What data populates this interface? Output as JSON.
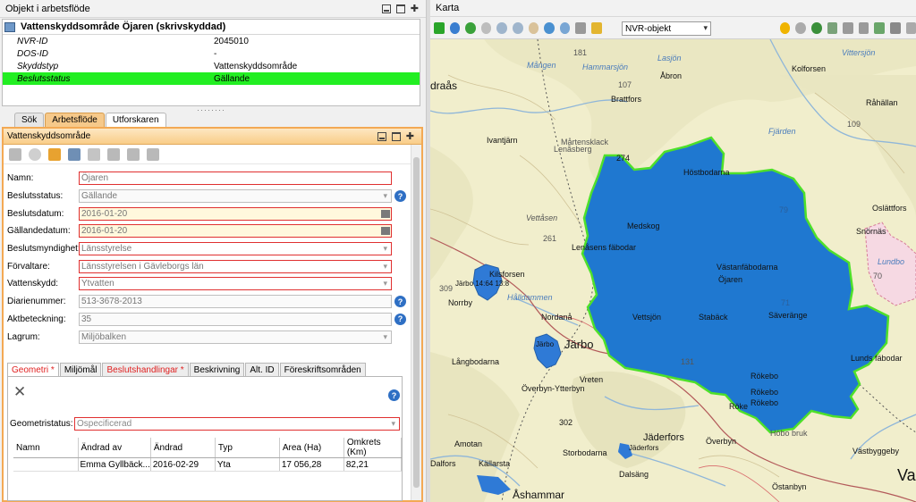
{
  "left_panel": {
    "title": "Objekt i arbetsflöde",
    "object_title": "Vattenskyddsområde Öjaren (skrivskyddad)",
    "attributes": [
      {
        "key": "NVR-ID",
        "value": "2045010"
      },
      {
        "key": "DOS-ID",
        "value": "-"
      },
      {
        "key": "Skyddstyp",
        "value": "Vattenskyddsområde"
      },
      {
        "key": "Beslutsstatus",
        "value": "Gällande"
      }
    ]
  },
  "tabs": [
    "Sök",
    "Arbetsflöde",
    "Utforskaren"
  ],
  "form": {
    "title": "Vattenskyddsområde",
    "fields": [
      {
        "label": "Namn:",
        "value": "Öjaren"
      },
      {
        "label": "Beslutsstatus:",
        "value": "Gällande"
      },
      {
        "label": "Beslutsdatum:",
        "value": "2016-01-20"
      },
      {
        "label": "Gällandedatum:",
        "value": "2016-01-20"
      },
      {
        "label": "Beslutsmyndighet:",
        "value": "Länsstyrelse"
      },
      {
        "label": "Förvaltare:",
        "value": "Länsstyrelsen i Gävleborgs län"
      },
      {
        "label": "Vattenskydd:",
        "value": "Ytvatten"
      },
      {
        "label": "Diarienummer:",
        "value": "513-3678-2013"
      },
      {
        "label": "Aktbeteckning:",
        "value": "35"
      },
      {
        "label": "Lagrum:",
        "value": "Miljöbalken"
      }
    ],
    "subtabs": [
      {
        "label": "Geometri",
        "star": "*"
      },
      {
        "label": "Miljömål",
        "star": ""
      },
      {
        "label": "Beslutshandlingar",
        "star": "*"
      },
      {
        "label": "Beskrivning",
        "star": ""
      },
      {
        "label": "Alt. ID",
        "star": ""
      },
      {
        "label": "Föreskriftsområden",
        "star": ""
      }
    ],
    "geometry_status_label": "Geometristatus:",
    "geometry_status_value": "Ospecificerad",
    "table": {
      "headers": [
        "Namn",
        "Ändrad av",
        "Ändrad",
        "Typ",
        "Area (Ha)",
        "Omkrets (Km)"
      ],
      "rows": [
        [
          "",
          "Emma Gyllbäck...",
          "2016-02-29",
          "Yta",
          "17 056,28",
          "82,21"
        ]
      ]
    }
  },
  "map": {
    "title": "Karta",
    "layer_select": "NVR-objekt",
    "labels": {
      "tl": "draås",
      "t1": "181",
      "t2": "Hammarsjön",
      "t3": "Mången",
      "t4": "Lasjön",
      "t5": "Åbron",
      "t6": "Vittersjön",
      "t7": "Kolforsen",
      "t8": "Råhällan",
      "t9": "Brattfors",
      "t10": "107",
      "t11": "Mårtensklack",
      "t12": "Lenåsberg",
      "t13": "274",
      "t14": "Höstbodarna",
      "t15": "Fjärden",
      "t16": "109",
      "t17": "Ivantjärn",
      "t18": "Vettåsen",
      "t19": "261",
      "t20": "Medskog",
      "t21": "Lenåsens fäbodar",
      "t22": "Västanfäbodarna",
      "t23": "Öjaren",
      "t24": "79",
      "t25": "Oslättfors",
      "t26": "Snörnäs",
      "t27": "Lundbo",
      "t28": "70",
      "t29": "Kilsforsen",
      "t30": "Järbo 14:64 13:8",
      "t31": "309",
      "t32": "Hålldammen",
      "t33": "Norrby",
      "t34": "Nordanå",
      "t35": "Vettsjön",
      "t36": "Stabäck",
      "t37": "Säveränge",
      "t38": "71",
      "t39": "Järbo",
      "t40": "Järbo",
      "t41": "Långbodarna",
      "t42": "Vreten",
      "t43": "131",
      "t44": "Rökebo",
      "t45": "Rökebo",
      "t46": "Lunds fäbodar",
      "t47": "Överbyn-Ytterbyn",
      "t48": "302",
      "t49": "Jäderfors",
      "t50": "Överbyn",
      "t51": "Amotan",
      "t52": "Storbodarna",
      "t53": "Jäderfors",
      "t54": "Höbo bruk",
      "t55": "Västbyggeby",
      "t56": "Dalfors",
      "t57": "Källarsta",
      "t58": "Dalsäng",
      "t59": "Östanbyn",
      "t60": "Åshammar",
      "t61": "Va",
      "t62": "Rökebo",
      "t63": "Röke"
    }
  }
}
